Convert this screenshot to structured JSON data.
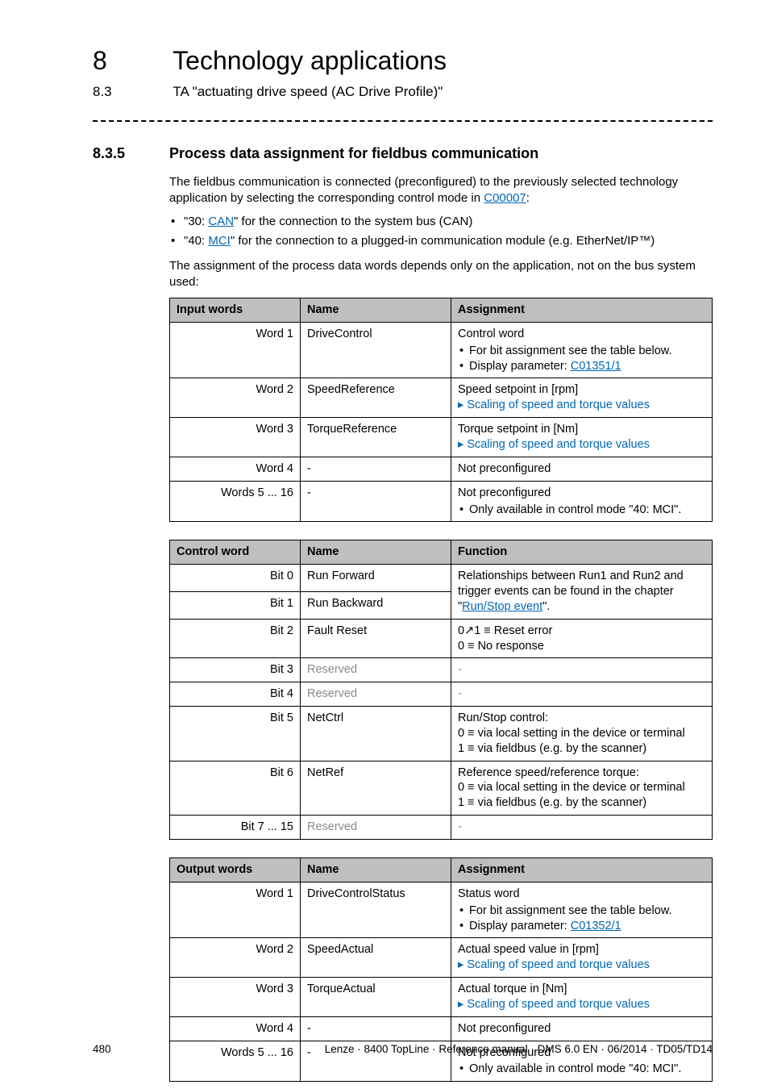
{
  "header": {
    "chapter_num": "8",
    "chapter_title": "Technology applications",
    "sub_num": "8.3",
    "sub_title": "TA \"actuating drive speed (AC Drive Profile)\""
  },
  "section": {
    "num": "8.3.5",
    "title": "Process data assignment for fieldbus communication",
    "intro_a": "The fieldbus communication is connected (preconfigured) to the previously selected technology application by selecting the corresponding control mode in ",
    "intro_link": "C00007",
    "intro_b": ":",
    "bullet1_a": "\"30: ",
    "bullet1_link": "CAN",
    "bullet1_b": "\" for the connection to the system bus (CAN)",
    "bullet2_a": "\"40: ",
    "bullet2_link": "MCI",
    "bullet2_b": "\" for the connection to a plugged-in communication module (e.g. EtherNet/IP™)",
    "outro": "The assignment of the process data words depends only on the application, not on the bus system used:"
  },
  "table_input": {
    "h1": "Input words",
    "h2": "Name",
    "h3": "Assignment",
    "r": [
      {
        "c1": "Word 1",
        "c2": "DriveControl",
        "a1": "Control word",
        "a2": "For bit assignment see the table below.",
        "a3": "Display parameter: ",
        "a3link": "C01351/1"
      },
      {
        "c1": "Word 2",
        "c2": "SpeedReference",
        "a1": "Speed setpoint in [rpm]",
        "alink": "Scaling of speed and torque values"
      },
      {
        "c1": "Word 3",
        "c2": "TorqueReference",
        "a1": "Torque setpoint in [Nm]",
        "alink": "Scaling of speed and torque values"
      },
      {
        "c1": "Word 4",
        "c2": "-",
        "a1": "Not preconfigured"
      },
      {
        "c1": "Words 5 ... 16",
        "c2": "-",
        "a1": "Not preconfigured",
        "a2": "Only available in control mode \"40: MCI\"."
      }
    ]
  },
  "table_cw": {
    "h1": "Control word",
    "h2": "Name",
    "h3": "Function",
    "r": [
      {
        "c1": "Bit 0",
        "c2": "Run Forward"
      },
      {
        "c1": "Bit 1",
        "c2": "Run Backward"
      },
      {
        "c1": "Bit 2",
        "c2": "Fault Reset",
        "f1": "0↗1 ≡ Reset error",
        "f2": "0 ≡ No response"
      },
      {
        "c1": "Bit 3",
        "c2": "Reserved",
        "f1": "-",
        "grey": true
      },
      {
        "c1": "Bit 4",
        "c2": "Reserved",
        "f1": "-",
        "grey": true
      },
      {
        "c1": "Bit 5",
        "c2": "NetCtrl",
        "f1": "Run/Stop control:",
        "f2": "0 ≡ via local setting in the device or terminal",
        "f3": "1 ≡ via fieldbus (e.g. by the scanner)"
      },
      {
        "c1": "Bit 6",
        "c2": "NetRef",
        "f1": "Reference speed/reference torque:",
        "f2": "0 ≡ via local setting in the device or terminal",
        "f3": "1 ≡ via fieldbus (e.g. by the scanner)"
      },
      {
        "c1": "Bit 7 ... 15",
        "c2": "Reserved",
        "f1": "-",
        "grey": true
      }
    ],
    "span_a": "Relationships between Run1 and Run2 and trigger events can be found in the chapter \"",
    "span_link": "Run/Stop event",
    "span_b": "\"."
  },
  "table_output": {
    "h1": "Output words",
    "h2": "Name",
    "h3": "Assignment",
    "r": [
      {
        "c1": "Word 1",
        "c2": "DriveControlStatus",
        "a1": "Status word",
        "a2": "For bit assignment see the table below.",
        "a3": "Display parameter: ",
        "a3link": "C01352/1"
      },
      {
        "c1": "Word 2",
        "c2": "SpeedActual",
        "a1": "Actual speed value in [rpm]",
        "alink": "Scaling of speed and torque values"
      },
      {
        "c1": "Word 3",
        "c2": "TorqueActual",
        "a1": "Actual torque in [Nm]",
        "alink": "Scaling of speed and torque values"
      },
      {
        "c1": "Word 4",
        "c2": "-",
        "a1": "Not preconfigured"
      },
      {
        "c1": "Words 5 ... 16",
        "c2": "-",
        "a1": "Not preconfigured",
        "a2": "Only available in control mode \"40: MCI\"."
      }
    ]
  },
  "footer": {
    "page": "480",
    "meta": "Lenze · 8400 TopLine · Reference manual · DMS 6.0 EN · 06/2014 · TD05/TD14"
  }
}
